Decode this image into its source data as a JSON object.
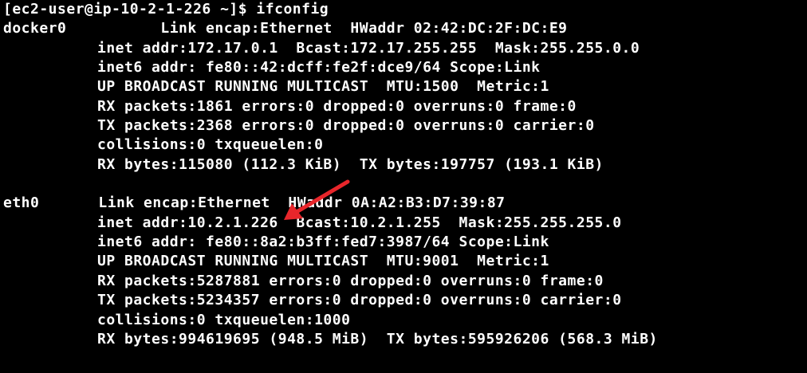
{
  "terminal": {
    "prompt": "[ec2-user@ip-10-2-1-226 ~]$ ifconfig",
    "docker0": {
      "name": "docker0",
      "lines": [
        "Link encap:Ethernet  HWaddr 02:42:DC:2F:DC:E9",
        "inet addr:172.17.0.1  Bcast:172.17.255.255  Mask:255.255.0.0",
        "inet6 addr: fe80::42:dcff:fe2f:dce9/64 Scope:Link",
        "UP BROADCAST RUNNING MULTICAST  MTU:1500  Metric:1",
        "RX packets:1861 errors:0 dropped:0 overruns:0 frame:0",
        "TX packets:2368 errors:0 dropped:0 overruns:0 carrier:0",
        "collisions:0 txqueuelen:0",
        "RX bytes:115080 (112.3 KiB)  TX bytes:197757 (193.1 KiB)"
      ]
    },
    "eth0": {
      "name": "eth0",
      "lines": [
        "Link encap:Ethernet  HWaddr 0A:A2:B3:D7:39:87",
        "inet addr:10.2.1.226  Bcast:10.2.1.255  Mask:255.255.255.0",
        "inet6 addr: fe80::8a2:b3ff:fed7:3987/64 Scope:Link",
        "UP BROADCAST RUNNING MULTICAST  MTU:9001  Metric:1",
        "RX packets:5287881 errors:0 dropped:0 overruns:0 frame:0",
        "TX packets:5234357 errors:0 dropped:0 overruns:0 carrier:0",
        "collisions:0 txqueuelen:1000",
        "RX bytes:994619695 (948.5 MiB)  TX bytes:595926206 (568.3 MiB)"
      ]
    }
  },
  "colors": {
    "background": "#000000",
    "text": "#ffffff",
    "arrow": "#e8262b"
  },
  "annotation": {
    "icon": "red-arrow-icon"
  }
}
